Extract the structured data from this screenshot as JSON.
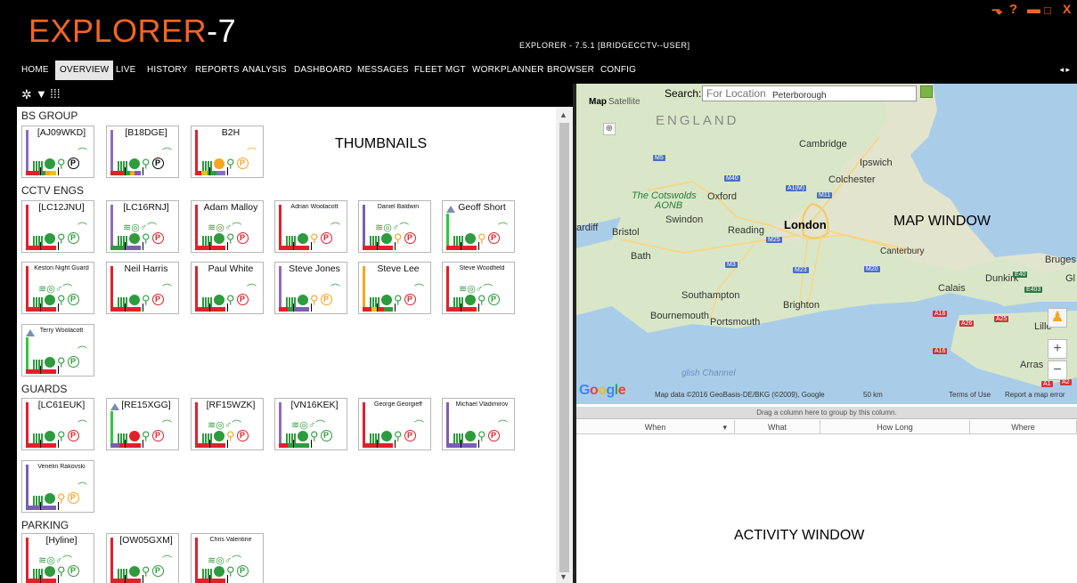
{
  "app": {
    "logo_main": "EXPLORER",
    "logo_num": "-7",
    "version": "EXPLORER - 7.5.1  [BRIDGECCTV--USER]"
  },
  "window_controls": [
    "⬎",
    "?",
    "▬",
    "□",
    "X"
  ],
  "menu": [
    "HOME",
    "OVERVIEW",
    "LIVE",
    "HISTORY",
    "REPORTS",
    "ANALYSIS",
    "DASHBOARD",
    "MESSAGES",
    "FLEET MGT",
    "WORKPLANNER",
    "BROWSER",
    "CONFIG"
  ],
  "menu_active": "OVERVIEW",
  "menu_arrows": "◂ ▸",
  "toolbar_icons": [
    "gear-icon",
    "filter-icon",
    "grid-icon"
  ],
  "groups": {
    "bs_group": "BS GROUP",
    "cctv_engs": "CCTV ENGS",
    "guards": "GUARDS",
    "parking": "PARKING"
  },
  "cards": {
    "aj09wkd": "[AJ09WKD]",
    "b18dge": "[B18DGE]",
    "b2h": "B2H",
    "lc12jnu": "[LC12JNU]",
    "lc16rnj": "[LC16RNJ]",
    "adam": "Adam Malloy",
    "adrian": "Adrian Woolacott",
    "daniel": "Daniel Baldwin",
    "geoff": "Geoff Short",
    "keston": "Keston Night Guard",
    "neil": "Neil Harris",
    "paul": "Paul White",
    "steve_jones": "Steve Jones",
    "steve_lee": "Steve Lee",
    "steve_woodfield": "Steve Woodfield",
    "terry": "Terry Woolacott",
    "lc61euk": "[LC61EUK]",
    "re15xgg": "[RE15XGG]",
    "rf15wzk": "[RF15WZK]",
    "vn16kek": "[VN16KEK]",
    "george": "George Georgieff",
    "michael": "Michael Vladimirov",
    "venelin": "Venelin Rakovski",
    "hyline": "[Hyline]",
    "ow05gxm": "[OW05GXM]",
    "chris": "Chris Valentine"
  },
  "annotations": {
    "thumbnails": "THUMBNAILS",
    "map_window": "MAP WINDOW",
    "activity_window": "ACTIVITY WINDOW"
  },
  "map": {
    "tab_map": "Map",
    "tab_satellite": "Satellite",
    "search_label": "Search:",
    "search_placeholder": "For Location",
    "places": {
      "england": "ENGLAND",
      "peterborough": "Peterborough",
      "cambridge": "Cambridge",
      "ipswich": "Ipswich",
      "colchester": "Colchester",
      "cotswolds": "The Cotswolds",
      "aonb": "AONB",
      "oxford": "Oxford",
      "swindon": "Swindon",
      "london": "London",
      "cardiff": "ardiff",
      "bristol": "Bristol",
      "reading": "Reading",
      "bath": "Bath",
      "canterbury": "Canterbury",
      "bruges": "Bruges",
      "dunkirk": "Dunkirk",
      "calais": "Calais",
      "southampton": "Southampton",
      "brighton": "Brighton",
      "bournemouth": "Bournemouth",
      "portsmouth": "Portsmouth",
      "lille": "Lille",
      "arras": "Arras",
      "channel": "glish Channel",
      "gl": "Gl"
    },
    "roads": {
      "m5": "M5",
      "m40": "M40",
      "a1m": "A1(M)",
      "m11": "M11",
      "m25": "M25",
      "m3": "M3",
      "m23": "M23",
      "m20": "M20",
      "e40": "E40",
      "e403": "E403",
      "a16a": "A16",
      "a25": "A25",
      "a26": "A26",
      "a16b": "A16",
      "a1": "A1",
      "a2": "A2"
    },
    "google": "Google",
    "credit": "Map data ©2016 GeoBasis-DE/BKG (©2009), Google",
    "scale": "50 km",
    "terms": "Terms of Use",
    "report": "Report a map error",
    "zoom_in": "+",
    "zoom_out": "−"
  },
  "activity": {
    "group_hint": "Drag a column here to group by this column.",
    "columns": [
      "When",
      "What",
      "How Long",
      "Where"
    ]
  },
  "colors": {
    "accent": "#f26522",
    "green": "#2e9b3e",
    "red": "#e0212b",
    "orange": "#f5a623"
  }
}
